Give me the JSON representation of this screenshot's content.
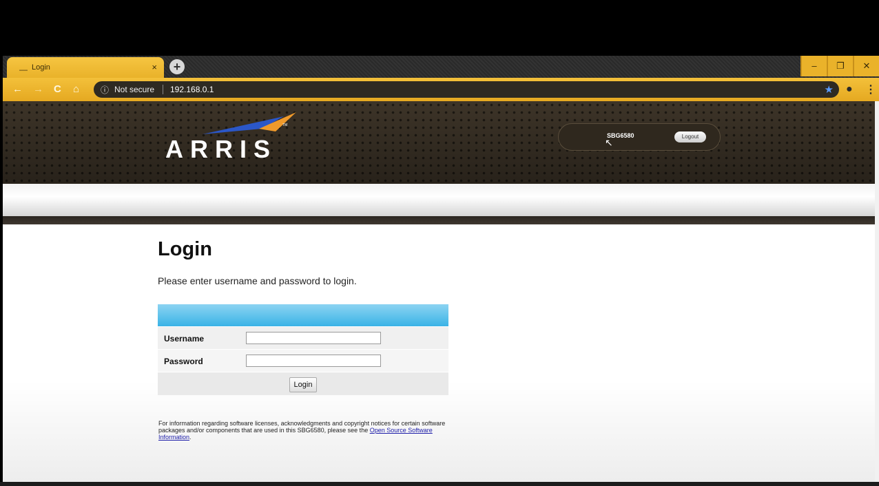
{
  "browser": {
    "tab_title": "Login",
    "tab_close": "×",
    "new_tab": "+",
    "window_controls": {
      "minimize": "–",
      "restore": "❐",
      "close": "✕"
    },
    "nav": {
      "back": "←",
      "forward": "→",
      "reload": "C",
      "home": "⌂"
    },
    "security_label": "Not secure",
    "url": "192.168.0.1",
    "accent_color": "#efb930"
  },
  "header": {
    "logo_text": "ARRIS",
    "device_name": "SBG6580",
    "logout_label": "Logout"
  },
  "login": {
    "title": "Login",
    "description": "Please enter username and password to login.",
    "username_label": "Username",
    "password_label": "Password",
    "username_value": "",
    "password_value": "",
    "button_label": "Login"
  },
  "notice": {
    "text": "For information regarding software licenses, acknowledgments and copyright notices for certain software packages and/or components that are used in this SBG6580, please see the ",
    "link_text": "Open Source Software Information",
    "suffix": "."
  }
}
